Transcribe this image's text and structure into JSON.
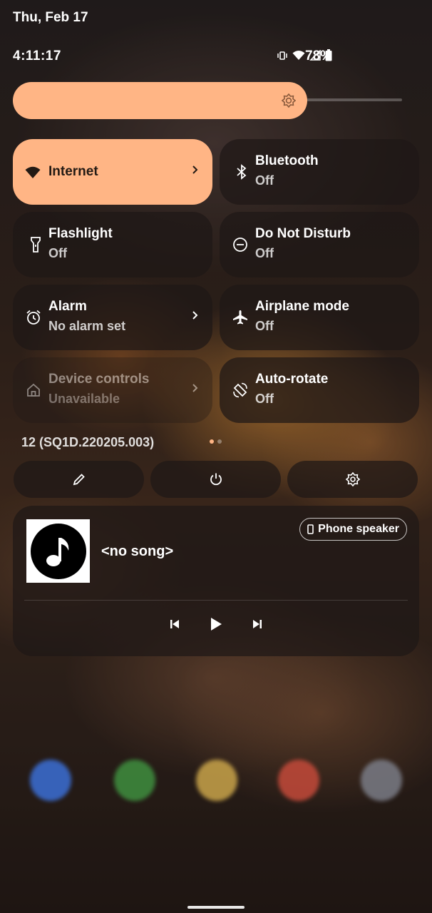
{
  "status_bar": {
    "date": "Thu, Feb 17",
    "time": "4:11:17",
    "battery": "78%"
  },
  "tiles": [
    {
      "title": "Internet",
      "subtitle": "",
      "icon": "wifi-icon"
    },
    {
      "title": "Bluetooth",
      "subtitle": "Off",
      "icon": "bluetooth-icon"
    },
    {
      "title": "Flashlight",
      "subtitle": "Off",
      "icon": "flashlight-icon"
    },
    {
      "title": "Do Not Disturb",
      "subtitle": "Off",
      "icon": "do-not-disturb-icon"
    },
    {
      "title": "Alarm",
      "subtitle": "No alarm set",
      "icon": "alarm-icon"
    },
    {
      "title": "Airplane mode",
      "subtitle": "Off",
      "icon": "airplane-icon"
    },
    {
      "title": "Device controls",
      "subtitle": "Unavailable",
      "icon": "home-icon"
    },
    {
      "title": "Auto-rotate",
      "subtitle": "Off",
      "icon": "auto-rotate-icon"
    }
  ],
  "build_number": "12 (SQ1D.220205.003)",
  "actions": {
    "edit_icon": "pencil-icon",
    "power_icon": "power-icon",
    "settings_icon": "gear-icon"
  },
  "media": {
    "song": "<no song>",
    "output": "Phone speaker"
  },
  "colors": {
    "accent": "#ffb585",
    "tile_bg": "#1e1816"
  }
}
